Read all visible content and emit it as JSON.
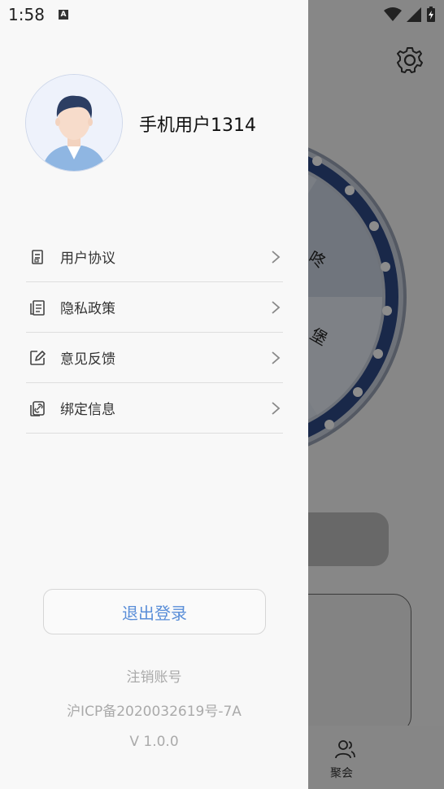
{
  "status_bar": {
    "time": "1:58",
    "notification_badge": "A"
  },
  "background_app": {
    "wheel_labels": [
      "咚",
      "堡"
    ],
    "bottom_nav_label": "聚会"
  },
  "drawer": {
    "username": "手机用户1314",
    "menu": [
      {
        "label": "用户协议",
        "icon": "document-icon"
      },
      {
        "label": "隐私政策",
        "icon": "pages-icon"
      },
      {
        "label": "意见反馈",
        "icon": "edit-icon"
      },
      {
        "label": "绑定信息",
        "icon": "link-icon"
      }
    ],
    "logout_label": "退出登录",
    "cancel_account": "注销账号",
    "icp": "沪ICP备2020032619号-7A",
    "version": "V 1.0.0"
  },
  "colors": {
    "accent": "#5a8ed8",
    "muted_text": "#aaaaaa"
  }
}
